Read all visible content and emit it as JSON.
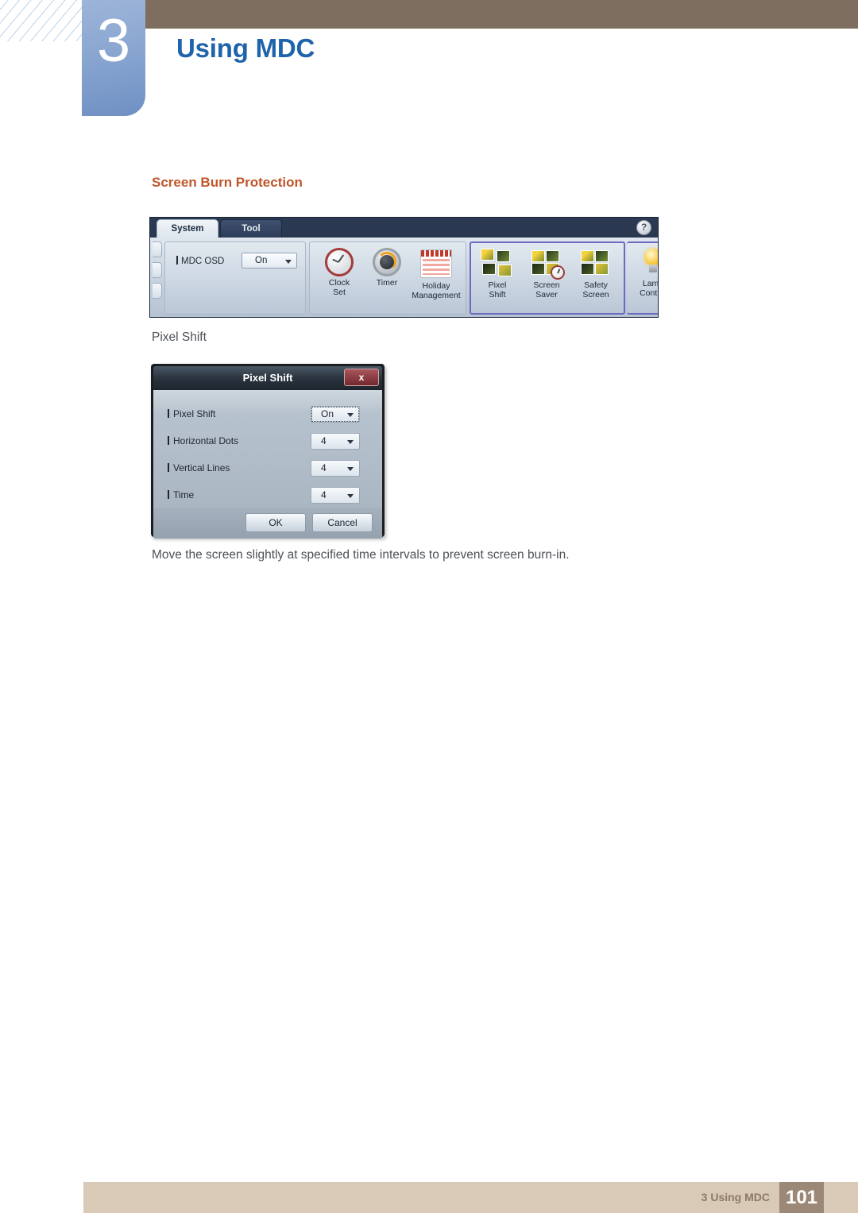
{
  "header": {
    "chapter_number": "3",
    "chapter_title": "Using MDC",
    "band_color": "#7d6e5f",
    "badge_color": "#8da9d2",
    "title_color": "#1f64ab"
  },
  "content": {
    "section_heading": "Screen Burn Protection",
    "section_heading_color": "#c0562a",
    "sub_heading": "Pixel Shift",
    "body_text": "Move the screen slightly at specified time intervals to prevent screen burn-in."
  },
  "mdc_toolbar": {
    "tabs": [
      {
        "label": "System",
        "active": true
      },
      {
        "label": "Tool",
        "active": false
      }
    ],
    "osd": {
      "label": "MDC OSD",
      "value": "On"
    },
    "tools": [
      {
        "label_line1": "Clock",
        "label_line2": "Set",
        "icon": "clock-icon"
      },
      {
        "label_line1": "Timer",
        "label_line2": "",
        "icon": "timer-icon"
      },
      {
        "label_line1": "Holiday",
        "label_line2": "Management",
        "icon": "calendar-icon"
      },
      {
        "label_line1": "Pixel",
        "label_line2": "Shift",
        "icon": "pixel-grid-icon"
      },
      {
        "label_line1": "Screen",
        "label_line2": "Saver",
        "icon": "screen-saver-icon"
      },
      {
        "label_line1": "Safety",
        "label_line2": "Screen",
        "icon": "safety-screen-icon"
      },
      {
        "label_line1": "Lamp",
        "label_line2": "Control",
        "icon": "lightbulb-icon"
      }
    ],
    "help_label": "?",
    "highlight_color": "#6f68c0"
  },
  "pixel_shift_dialog": {
    "title": "Pixel Shift",
    "close_label": "x",
    "rows": [
      {
        "label": "Pixel Shift",
        "value": "On",
        "focused": true
      },
      {
        "label": "Horizontal Dots",
        "value": "4",
        "focused": false
      },
      {
        "label": "Vertical Lines",
        "value": "4",
        "focused": false
      },
      {
        "label": "Time",
        "value": "4",
        "focused": false
      }
    ],
    "ok_label": "OK",
    "cancel_label": "Cancel"
  },
  "footer": {
    "text": "3 Using MDC",
    "page_number": "101",
    "bar_color": "#d8cab6",
    "page_box_color": "#9c8876"
  }
}
